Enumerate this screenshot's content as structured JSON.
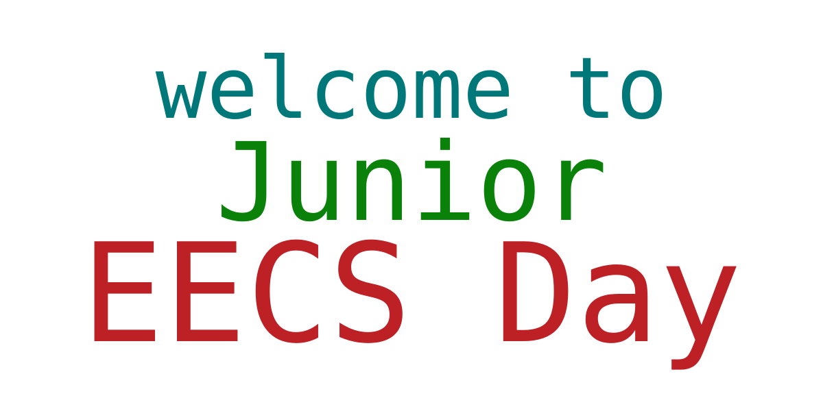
{
  "banner": {
    "line_1": {
      "text": "welcome to",
      "color": "#00787a"
    },
    "line_2": {
      "text": "Junior",
      "color": "#0a820a"
    },
    "line_3": {
      "text": "EECS Day",
      "color": "#bd2025"
    }
  }
}
